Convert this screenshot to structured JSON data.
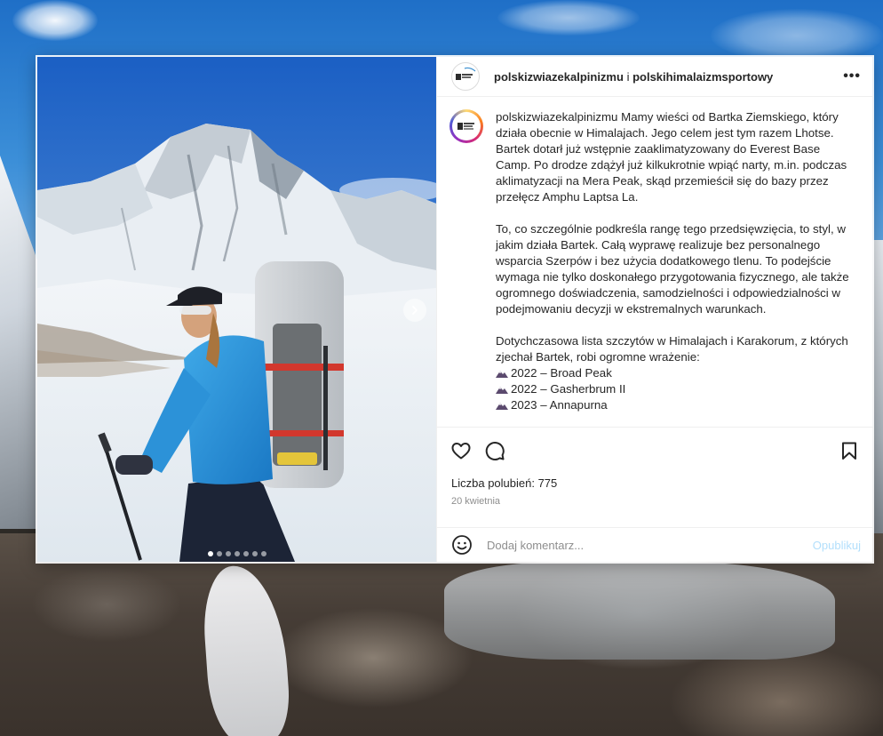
{
  "post": {
    "header": {
      "username": "polskizwiazekalpinizmu",
      "separator": "i",
      "collaborator": "polskihimalaizmsportowy",
      "more_label": "•••"
    },
    "caption": {
      "username": "polskizwiazekalpinizmu",
      "paragraph1": "Mamy wieści od Bartka Ziemskiego, który działa obecnie w Himalajach. Jego celem jest tym razem Lhotse. Bartek dotarł już wstępnie zaaklimatyzowany do Everest Base Camp. Po drodze zdążył już kilkukrotnie wpiąć narty, m.in. podczas aklimatyzacji na Mera Peak, skąd przemieścił się do bazy przez przełęcz Amphu Laptsa La.",
      "paragraph2": "To, co szczególnie podkreśla rangę tego przedsięwzięcia, to styl, w jakim działa Bartek. Całą wyprawę realizuje bez personalnego wsparcia Szerpów i bez użycia dodatkowego tlenu. To podejście wymaga nie tylko doskonałego przygotowania fizycznego, ale także ogromnego doświadczenia, samodzielności i odpowiedzialności w podejmowaniu decyzji w ekstremalnych warunkach.",
      "paragraph3": "Dotychczasowa lista szczytów w Himalajach i Karakorum, z których zjechał Bartek, robi ogromne wrażenie:",
      "peaks": [
        "2022 – Broad Peak",
        "2022 – Gasherbrum II",
        "2023 – Annapurna"
      ]
    },
    "likes_text": "Liczba polubień: 775",
    "date_text": "20 kwietnia",
    "comment": {
      "placeholder": "Dodaj komentarz...",
      "value": "",
      "post_label": "Opublikuj"
    },
    "carousel": {
      "count": 7,
      "active_index": 0
    },
    "icons": {
      "like": "heart-icon",
      "comment": "comment-bubble-icon",
      "save": "bookmark-icon",
      "emoji": "emoji-smiley-icon",
      "next": "chevron-right-icon",
      "peak": "mountain-peak-icon"
    },
    "colors": {
      "post_button": "#b2dffc",
      "text": "#262626",
      "secondary_text": "#8e8e8e"
    }
  }
}
